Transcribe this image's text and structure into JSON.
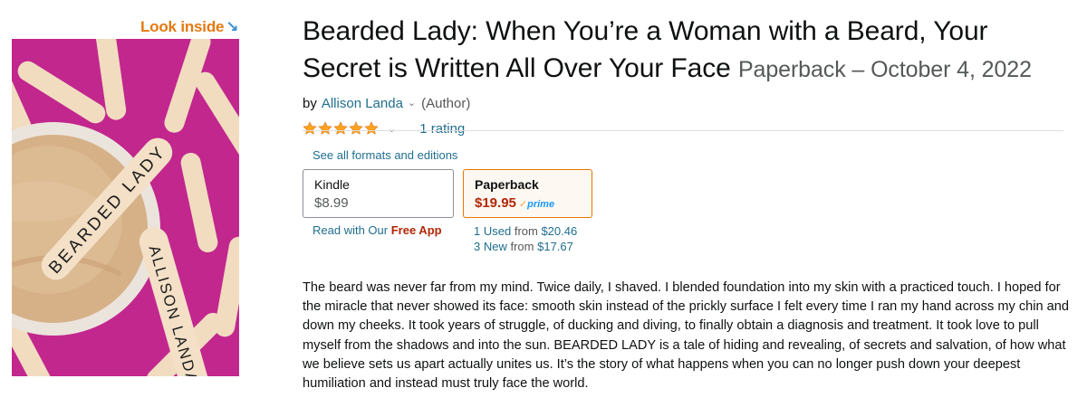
{
  "look_inside": {
    "label": "Look inside",
    "arrow": "↘"
  },
  "cover": {
    "title_text": "BEARDED LADY",
    "author_text": "ALLISON LANDA",
    "background_color": "#c2278e",
    "stick_color": "#f3e0c7",
    "cream_color": "#d9b68c"
  },
  "product": {
    "title": "Bearded Lady: When You’re a Woman with a Beard, Your Secret is Written All Over Your Face",
    "format_date": "Paperback – October 4, 2022",
    "by_label": "by",
    "author": "Allison Landa",
    "author_chevron": "⌄",
    "author_role": "(Author)",
    "rating": {
      "stars": 5,
      "chevron": "⌄",
      "count_text": "1 rating"
    }
  },
  "formats": {
    "see_all_label": "See all formats and editions",
    "options": [
      {
        "name": "Kindle",
        "price": "$8.99",
        "selected": false
      },
      {
        "name": "Paperback",
        "price": "$19.95",
        "selected": true,
        "prime_check": "✓",
        "prime_label": "prime"
      }
    ],
    "read_with_prefix": "Read with Our",
    "free_app_label": "Free App",
    "used_offer": {
      "count": "1 Used",
      "from_label": "from",
      "price": "$20.46"
    },
    "new_offer": {
      "count": "3 New",
      "from_label": "from",
      "price": "$17.67"
    }
  },
  "description": "The beard was never far from my mind. Twice daily, I shaved. I blended foundation into my skin with a practiced touch. I hoped for the miracle that never showed its face: smooth skin instead of the prickly surface I felt every time I ran my hand across my chin and down my cheeks. It took years of struggle, of ducking and diving, to finally obtain a diagnosis and treatment. It took love to pull myself from the shadows and into the sun. BEARDED LADY is a tale of hiding and revealing, of secrets and salvation, of how what we believe sets us apart actually unites us. It’s the story of what happens when you can no longer push down your deepest humiliation and instead must truly face the world.",
  "colors": {
    "link": "#1f6e8f",
    "price": "#b12704",
    "star": "#ffa41c",
    "look_inside": "#e47911",
    "selected_border": "#e77600"
  }
}
